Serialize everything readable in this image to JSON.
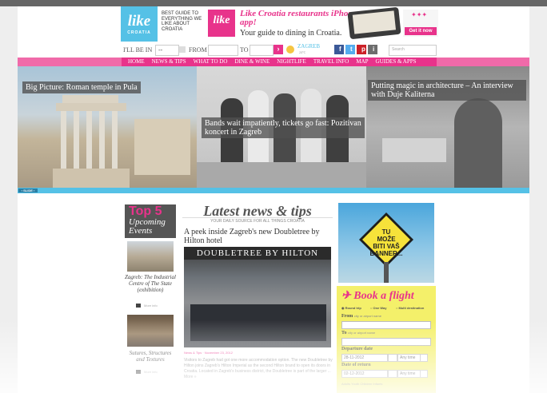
{
  "header": {
    "logo": "like",
    "logo_sub": "CROATIA",
    "tagline": "BEST GUIDE TO EVERYTHING WE LIKE ABOUT CROATIA",
    "banner": {
      "logo": "like",
      "title": "Like Croatia restaurants iPhone app!",
      "subtitle": "Your guide to dining in Croatia.",
      "cta": "Get it now"
    }
  },
  "search_row": {
    "ill_be_in_label": "I'LL BE IN",
    "ill_be_in_value": "--",
    "from_label": "FROM",
    "to_label": "TO",
    "go_label": "›",
    "city": "ZAGREB",
    "city_sub": "24°C",
    "search_placeholder": "Search"
  },
  "social": [
    "f",
    "t",
    "p",
    "i"
  ],
  "nav": {
    "items": [
      "HOME",
      "NEWS & TIPS",
      "WHAT TO DO",
      "DINE & WINE",
      "NIGHTLIFE",
      "TRAVEL INFO",
      "MAP",
      "GUIDES & APPS"
    ]
  },
  "hero": {
    "slides": [
      {
        "caption": "Big Picture: Roman temple in Pula"
      },
      {
        "caption": "Bands wait impatiently, tickets go fast: Pozitivan koncert in Zagreb"
      },
      {
        "caption": "Putting magic in architecture – An interview with Duje Kaliterna"
      }
    ],
    "slider_label": "‹ SLIDE ›"
  },
  "events": {
    "title": "Top 5",
    "subtitle": "Upcoming Events",
    "items": [
      {
        "title": "Zagreb: The Industrial Centre of The State (exhibition)",
        "meta": "More info"
      },
      {
        "title": "Sutures, Structures and Textures",
        "meta": "More info"
      }
    ]
  },
  "news": {
    "heading": "Latest news & tips",
    "subheading": "YOUR DAILY SOURCE FOR ALL THINGS CROATIA",
    "article_title": "A peek inside Zagreb's new Doubletree by Hilton hotel",
    "image_sign": "DOUBLETREE BY HILTON",
    "meta": "News & Tips · November 23, 2012",
    "body": "Visitors to Zagreb had got one more accommodation option. The new Doubletree by Hilton joins Zagreb's Hilton Imperial as the second Hilton brand to open its doors in Croatia. Located in Zagreb's business district, the Doubletree is part of the larger ... More »"
  },
  "ad": {
    "line1": "TU",
    "line2": "MOŽE",
    "line3": "BITI VAŠ",
    "line4": "BANNER..."
  },
  "flight": {
    "title": "Book a flight",
    "options": [
      "Round trip",
      "One Way",
      "Multi destination"
    ],
    "from_label": "From",
    "from_hint": "city or airport name",
    "to_label": "To",
    "to_hint": "city or airport name",
    "departure_label": "Departure date",
    "departure_value": "28-11-2012",
    "departure_time": "Any time",
    "return_label": "Date of return",
    "return_value": "02-12-2012",
    "return_time": "Any time",
    "pax": "Adults  Youth  Children  Infants"
  },
  "colors": {
    "accent_pink": "#e8338b",
    "accent_blue": "#55c1e6",
    "flight_yellow": "#f4f06a"
  }
}
